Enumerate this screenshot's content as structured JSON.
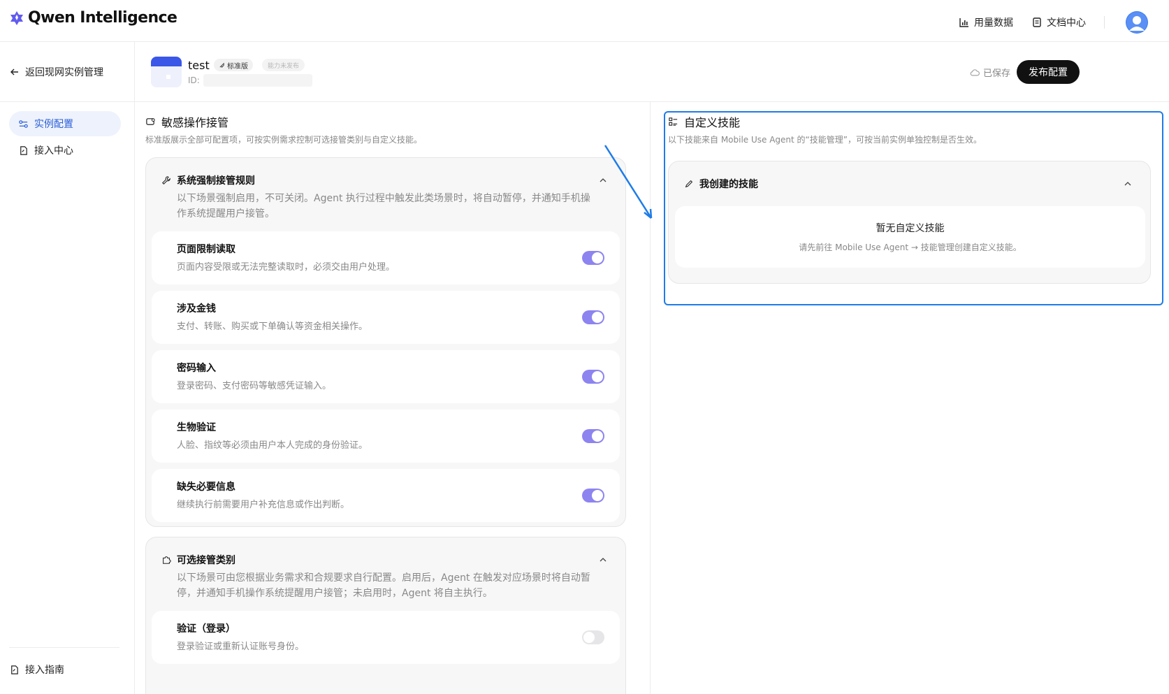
{
  "app": {
    "brand": "Qwen Intelligence"
  },
  "topnav": {
    "usage": "用量数据",
    "docs": "文档中心"
  },
  "sidebar": {
    "back": "返回现网实例管理",
    "items": [
      {
        "label": "实例配置",
        "active": true
      },
      {
        "label": "接入中心",
        "active": false
      }
    ],
    "guide": "接入指南"
  },
  "header": {
    "instance_name": "test",
    "tag_standard": "标准版",
    "tag_unpublished": "能力未发布",
    "id_label": "ID:",
    "saved": "已保存",
    "publish": "发布配置"
  },
  "sensitive": {
    "title": "敏感操作接管",
    "desc": "标准版展示全部可配置项，可按实例需求控制可选接管类别与自定义技能。",
    "forced": {
      "title": "系统强制接管规则",
      "desc": "以下场景强制启用，不可关闭。Agent 执行过程中触发此类场景时，将自动暂停，并通知手机操作系统提醒用户接管。",
      "rules": [
        {
          "title": "页面限制读取",
          "desc": "页面内容受限或无法完整读取时，必须交由用户处理。",
          "enabled": true
        },
        {
          "title": "涉及金钱",
          "desc": "支付、转账、购买或下单确认等资金相关操作。",
          "enabled": true
        },
        {
          "title": "密码输入",
          "desc": "登录密码、支付密码等敏感凭证输入。",
          "enabled": true
        },
        {
          "title": "生物验证",
          "desc": "人脸、指纹等必须由用户本人完成的身份验证。",
          "enabled": true
        },
        {
          "title": "缺失必要信息",
          "desc": "继续执行前需要用户补充信息或作出判断。",
          "enabled": true
        }
      ]
    },
    "optional": {
      "title": "可选接管类别",
      "desc": "以下场景可由您根据业务需求和合规要求自行配置。启用后，Agent 在触发对应场景时将自动暂停，并通知手机操作系统提醒用户接管；未启用时，Agent 将自主执行。",
      "rules": [
        {
          "title": "验证（登录）",
          "desc": "登录验证或重新认证账号身份。",
          "enabled": false
        }
      ]
    }
  },
  "custom": {
    "title": "自定义技能",
    "desc": "以下技能来自 Mobile Use Agent 的“技能管理”，可按当前实例单独控制是否生效。",
    "my_skills": "我创建的技能",
    "empty_title": "暂无自定义技能",
    "empty_desc": "请先前往 Mobile Use Agent → 技能管理创建自定义技能。"
  },
  "colors": {
    "accent": "#2a5fd9",
    "toggle_on": "#8d84f0",
    "highlight": "#1e7ce8",
    "brand": "#615ced"
  }
}
